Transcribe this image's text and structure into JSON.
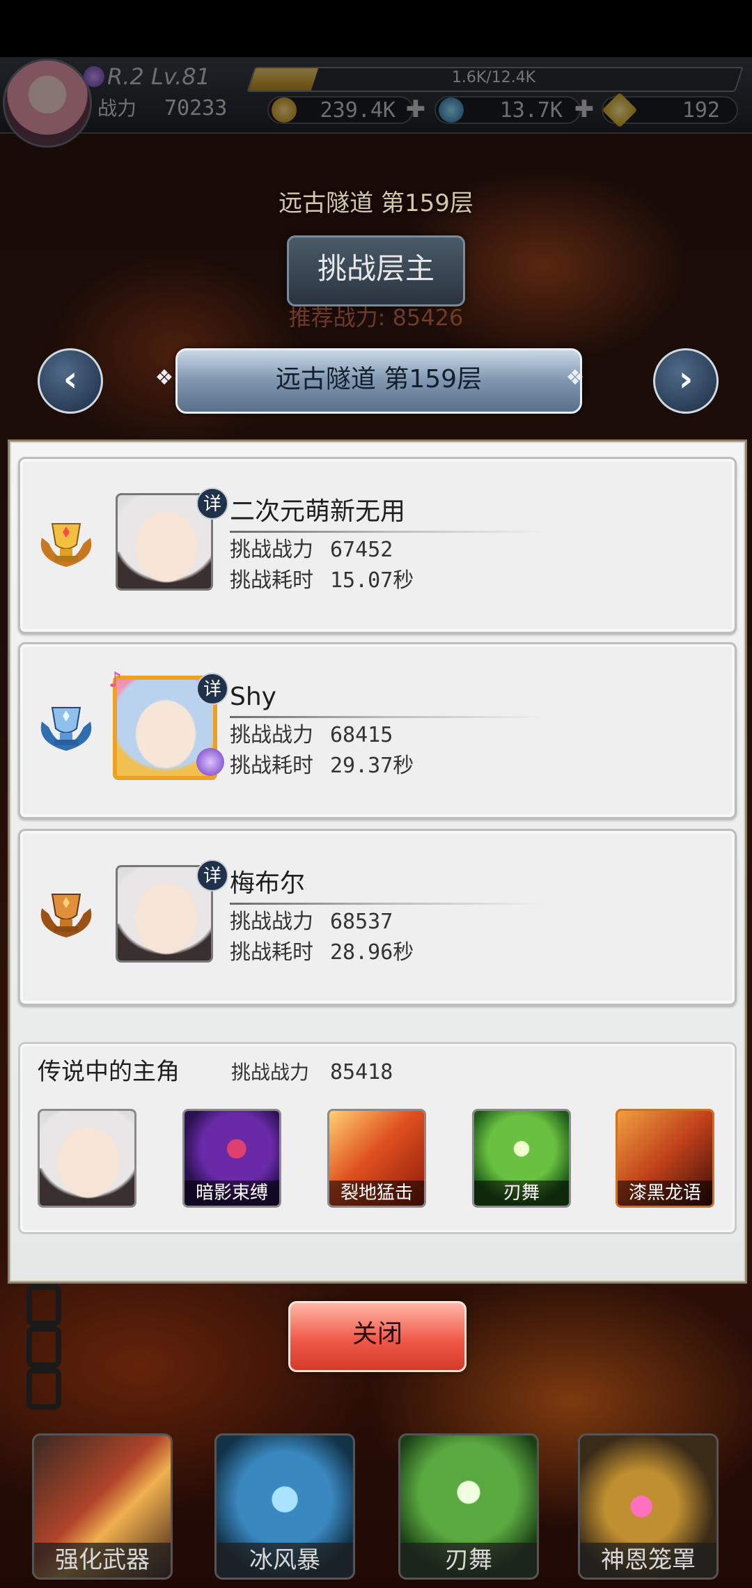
{
  "player": {
    "rank_level": "R.2 Lv.81",
    "xp_text": "1.6K/12.4K",
    "xp_progress": 0.129,
    "power_label": "战力",
    "power_value": "70233"
  },
  "resources": [
    {
      "name": "gold",
      "icon": "gold-coin-icon",
      "value": "239.4K"
    },
    {
      "name": "crystal",
      "icon": "blue-crystal-icon",
      "value": "13.7K"
    },
    {
      "name": "diamond",
      "icon": "yellow-diamond-icon",
      "value": "192"
    }
  ],
  "header": {
    "floor_title": "远古隧道 第159层",
    "boss_button": "挑战层主",
    "recommended_power": "推荐战力: 85426"
  },
  "banner": {
    "floor_title": "远古隧道 第159层",
    "prev_icon": "chevron-left-icon",
    "next_icon": "chevron-right-icon"
  },
  "records": [
    {
      "rank_icon": "gold-trophy-icon",
      "detail": "详",
      "name": "二次元萌新无用",
      "power_label": "挑战战力",
      "power": "67452",
      "time_label": "挑战耗时",
      "time": "15.07秒"
    },
    {
      "rank_icon": "silver-trophy-icon",
      "detail": "详",
      "name": "Shy",
      "power_label": "挑战战力",
      "power": "68415",
      "time_label": "挑战耗时",
      "time": "29.37秒"
    },
    {
      "rank_icon": "bronze-trophy-icon",
      "detail": "详",
      "name": "梅布尔",
      "power_label": "挑战战力",
      "power": "68537",
      "time_label": "挑战耗时",
      "time": "28.96秒"
    }
  ],
  "legend": {
    "title": "传说中的主角",
    "power_label": "挑战战力",
    "power": "85418",
    "skills": [
      "暗影束缚",
      "裂地猛击",
      "刃舞",
      "漆黑龙语"
    ]
  },
  "close_button": "关闭",
  "dock": [
    "强化武器",
    "冰风暴",
    "刃舞",
    "神恩笼罩"
  ],
  "colors": {
    "trophy_gold": "#e0a020",
    "trophy_silver": "#4a86c8",
    "trophy_bronze": "#c8781e",
    "close_button": "#f05a48",
    "banner": "#7f96ae"
  }
}
